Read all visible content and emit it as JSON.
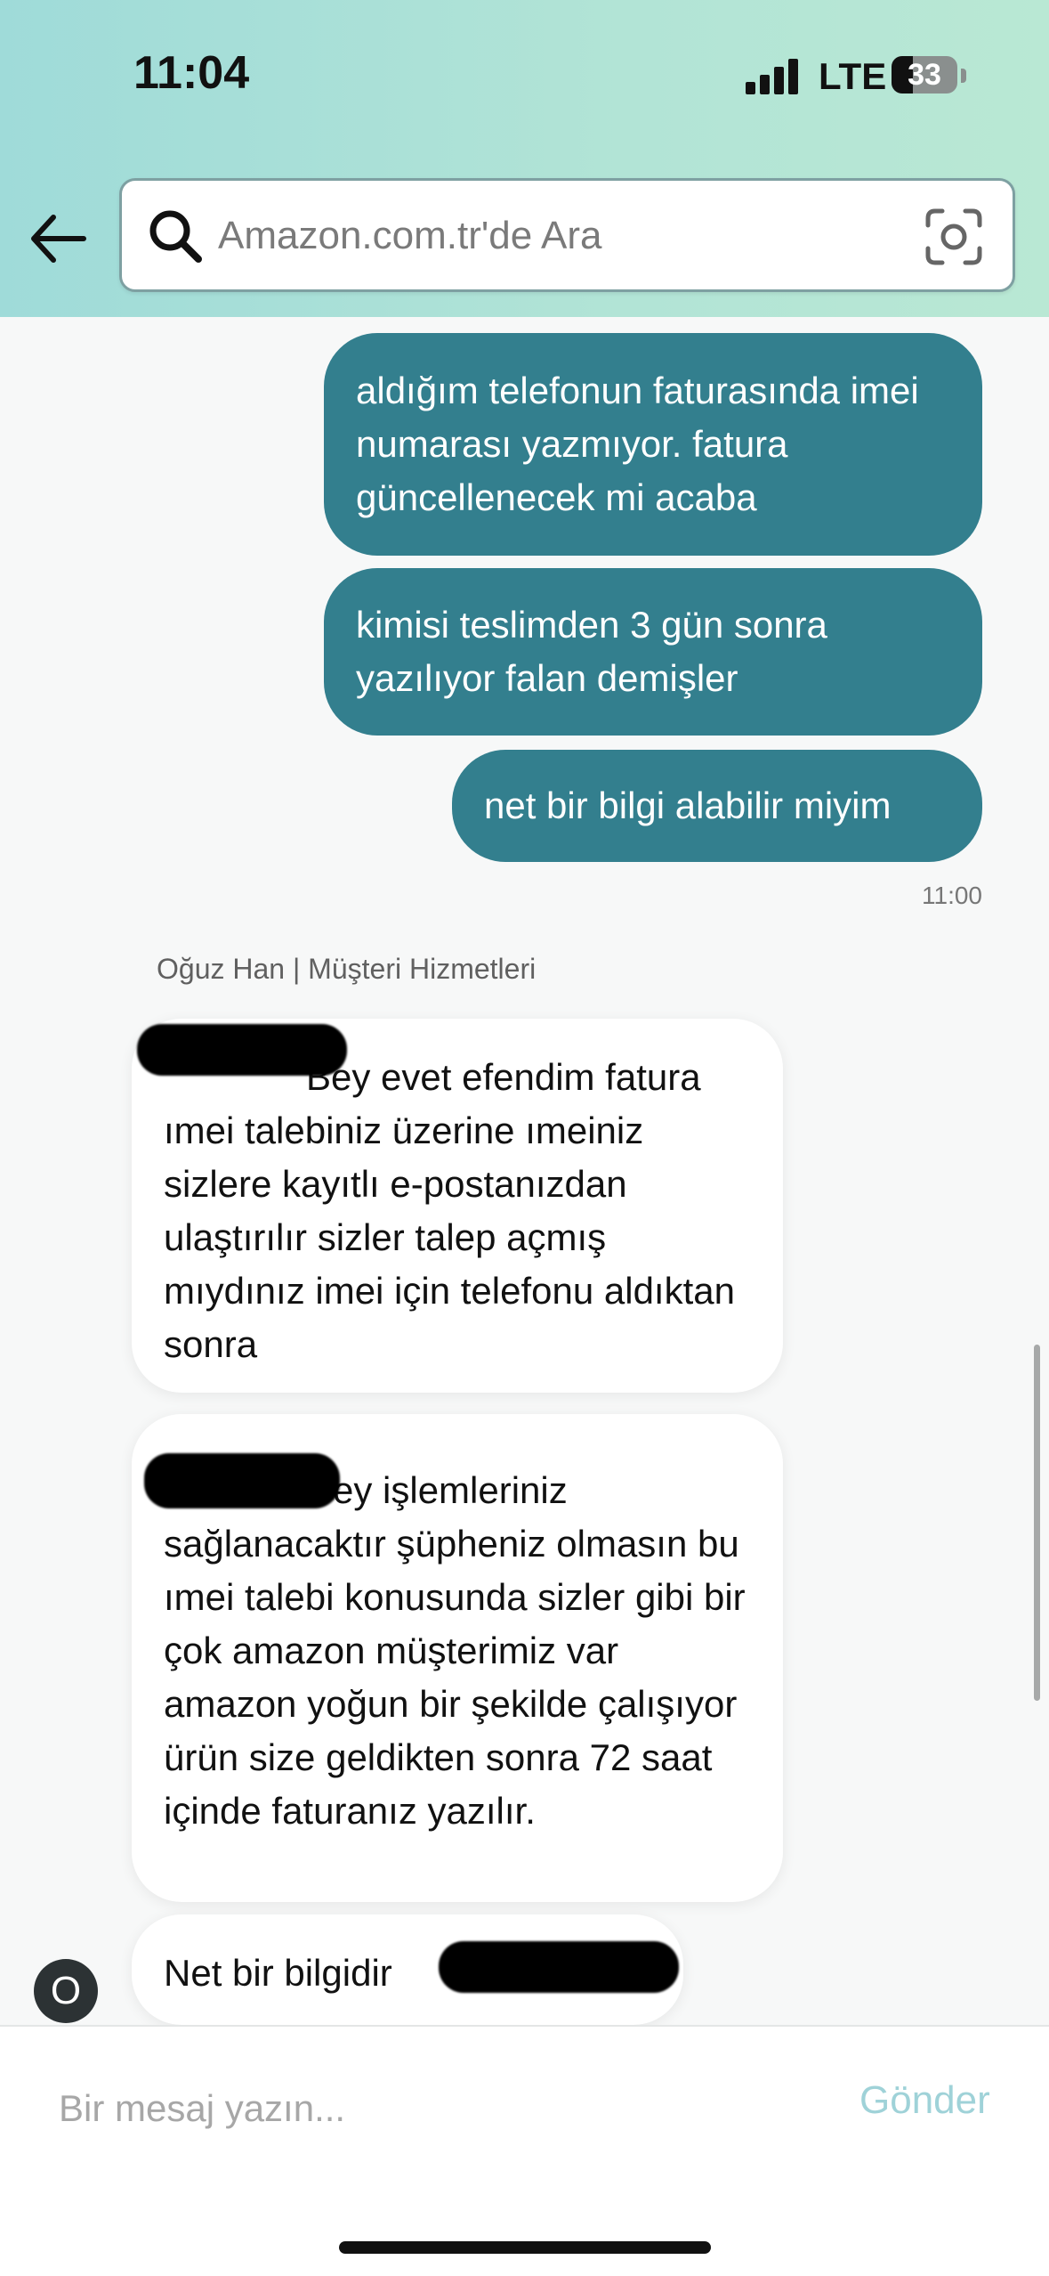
{
  "status_bar": {
    "time": "11:04",
    "network": "LTE",
    "battery": "33",
    "battery_level": 0.33
  },
  "search": {
    "placeholder": "Amazon.com.tr'de Ara"
  },
  "icons": {
    "back": "arrow-left-icon",
    "search": "search-icon",
    "camera": "camera-scan-icon"
  },
  "messages_out": [
    "aldığım telefonun faturasında imei numarası yazmıyor. fatura güncellenecek mi acaba",
    "kimisi teslimden 3 gün sonra yazılıyor falan demişler",
    "net bir bilgi alabilir miyim"
  ],
  "out_time": "11:00",
  "agent": {
    "name": "Oğuz Han | Müşteri Hizmetleri",
    "avatar_initial": "O"
  },
  "messages_in": [
    "Bey evet efendim fatura ımei talebiniz üzerine ımeiniz sizlere kayıtlı e-postanızdan ulaştırılır sizler talep açmış mıydınız imei için telefonu aldıktan sonra",
    "ey işlemleriniz sağlanacaktır şüpheniz olmasın bu ımei talebi konusunda sizler gibi bir çok amazon müşterimiz var amazon yoğun bir şekilde çalışıyor ürün size geldikten sonra 72 saat içinde faturanız yazılır.",
    "Net bir bilgidir"
  ],
  "composer": {
    "placeholder": "Bir mesaj yazın...",
    "send_label": "Gönder"
  },
  "colors": {
    "outgoing_bubble": "#337f8e",
    "send_button": "#9fd2d8",
    "header_gradient_start": "#9fdbd9",
    "header_gradient_end": "#b9e8d4"
  }
}
